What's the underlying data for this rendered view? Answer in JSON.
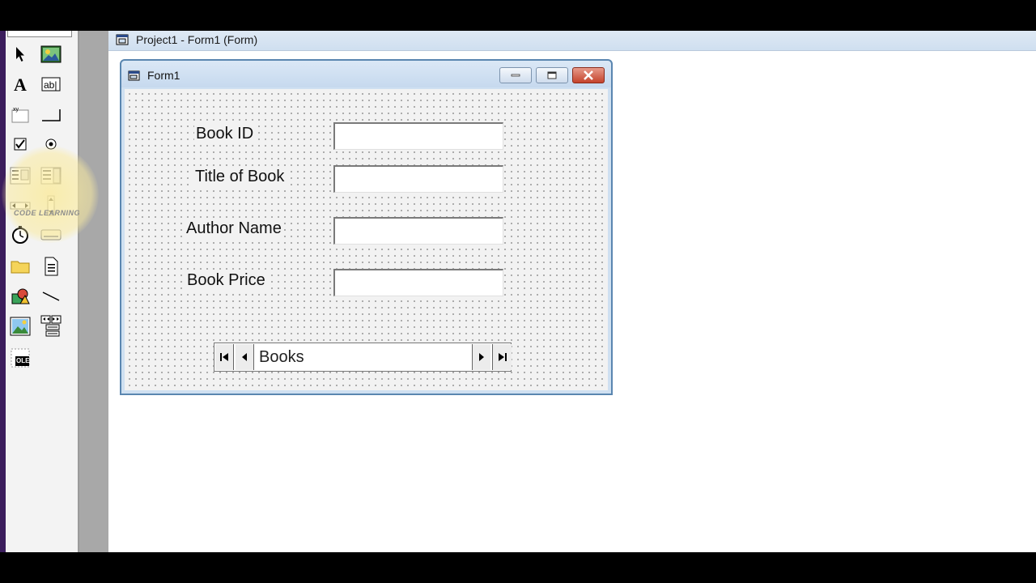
{
  "project_window": {
    "title": "Project1 - Form1 (Form)"
  },
  "form": {
    "title": "Form1",
    "fields": [
      {
        "label": "Book ID",
        "value": ""
      },
      {
        "label": "Title of Book",
        "value": ""
      },
      {
        "label": "Author Name",
        "value": ""
      },
      {
        "label": "Book Price",
        "value": ""
      }
    ],
    "data_control": {
      "caption": "Books"
    }
  },
  "toolbox": {
    "tools": [
      "pointer",
      "picturebox",
      "label",
      "textbox",
      "frame",
      "commandbutton",
      "checkbox",
      "optionbutton",
      "combobox",
      "listbox",
      "hscrollbar",
      "vscrollbar",
      "timer",
      "drivelistbox",
      "dirlistbox",
      "filelistbox",
      "shape",
      "line",
      "image",
      "data",
      "ole"
    ],
    "ole_text": "OLE"
  },
  "watermark": {
    "text": "CODE LEARNING"
  }
}
